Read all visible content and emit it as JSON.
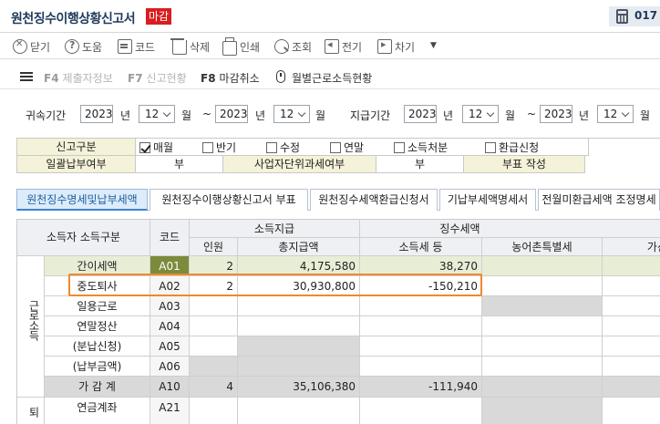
{
  "window": {
    "title": "원천징수이행상황신고서",
    "badge": "마감",
    "top_right": "017"
  },
  "toolbar": [
    {
      "label": "닫기",
      "icon": "close-icon"
    },
    {
      "label": "도움",
      "icon": "help-icon"
    },
    {
      "label": "코드",
      "icon": "code-icon"
    },
    {
      "label": "삭제",
      "icon": "trash-icon"
    },
    {
      "label": "인쇄",
      "icon": "print-icon"
    },
    {
      "label": "조회",
      "icon": "search-icon"
    },
    {
      "label": "전기",
      "icon": "prev-icon"
    },
    {
      "label": "차기",
      "icon": "next-icon"
    }
  ],
  "function_keys": [
    {
      "key": "F4",
      "label": "제출자정보",
      "enabled": false
    },
    {
      "key": "F7",
      "label": "신고현황",
      "enabled": false
    },
    {
      "key": "F8",
      "label": "마감취소",
      "enabled": true
    },
    {
      "key": "",
      "label": "월별근로소득현황",
      "enabled": true
    }
  ],
  "period": {
    "belong_label": "귀속기간",
    "belong_from_year": "2023",
    "belong_from_month": "12",
    "belong_to_year": "2023",
    "belong_to_month": "12",
    "pay_label": "지급기간",
    "pay_from_year": "2023",
    "pay_from_month": "12",
    "pay_to_year": "2023",
    "pay_to_month": "12",
    "year_unit": "년",
    "month_unit": "월",
    "tilde": "~"
  },
  "options": {
    "report_type_label": "신고구분",
    "items": [
      {
        "label": "매월",
        "checked": true
      },
      {
        "label": "반기",
        "checked": false
      },
      {
        "label": "수정",
        "checked": false
      },
      {
        "label": "연말",
        "checked": false
      },
      {
        "label": "소득처분",
        "checked": false
      },
      {
        "label": "환급신청",
        "checked": false
      }
    ],
    "lump_label": "일괄납부여부",
    "lump_value": "부",
    "unit_label": "사업자단위과세여부",
    "unit_value": "부",
    "appendix_label": "부표 작성"
  },
  "tabs": [
    {
      "label": "원천징수명세및납부세액",
      "active": true
    },
    {
      "label": "원천징수이행상황신고서 부표",
      "active": false
    },
    {
      "label": "원천징수세액환급신청서",
      "active": false
    },
    {
      "label": "기납부세액명세서",
      "active": false
    },
    {
      "label": "전월미환급세액 조정명세",
      "active": false
    }
  ],
  "grid": {
    "headers": {
      "income_type": "소득자 소득구분",
      "code": "코드",
      "pay_group": "소득지급",
      "persons": "인원",
      "total_pay": "총지급액",
      "tax_group": "징수세액",
      "income_tax": "소득세 등",
      "rural_tax": "농어촌특별세",
      "extra": "가산"
    },
    "group_label": "근로소득",
    "group2_label": "퇴",
    "rows": [
      {
        "name": "간이세액",
        "code": "A01",
        "persons": "2",
        "total": "4,175,580",
        "tax": "38,270"
      },
      {
        "name": "중도퇴사",
        "code": "A02",
        "persons": "2",
        "total": "30,930,800",
        "tax": "-150,210"
      },
      {
        "name": "일용근로",
        "code": "A03",
        "persons": "",
        "total": "",
        "tax": ""
      },
      {
        "name": "연말정산",
        "code": "A04",
        "persons": "",
        "total": "",
        "tax": ""
      },
      {
        "name": "(분납신청)",
        "code": "A05",
        "persons": "",
        "total": "",
        "tax": ""
      },
      {
        "name": "(납부금액)",
        "code": "A06",
        "persons": "",
        "total": "",
        "tax": ""
      },
      {
        "name": "가 감 계",
        "code": "A10",
        "persons": "4",
        "total": "35,106,380",
        "tax": "-111,940"
      },
      {
        "name": "연금계좌",
        "code": "A21",
        "persons": "",
        "total": "",
        "tax": ""
      }
    ]
  },
  "colors": {
    "badge": "#d81e1e",
    "highlight": "#f0882c",
    "active_tab": "#dcecfa",
    "header": "#f4f2d8",
    "code_selected": "#7c8a3c"
  }
}
